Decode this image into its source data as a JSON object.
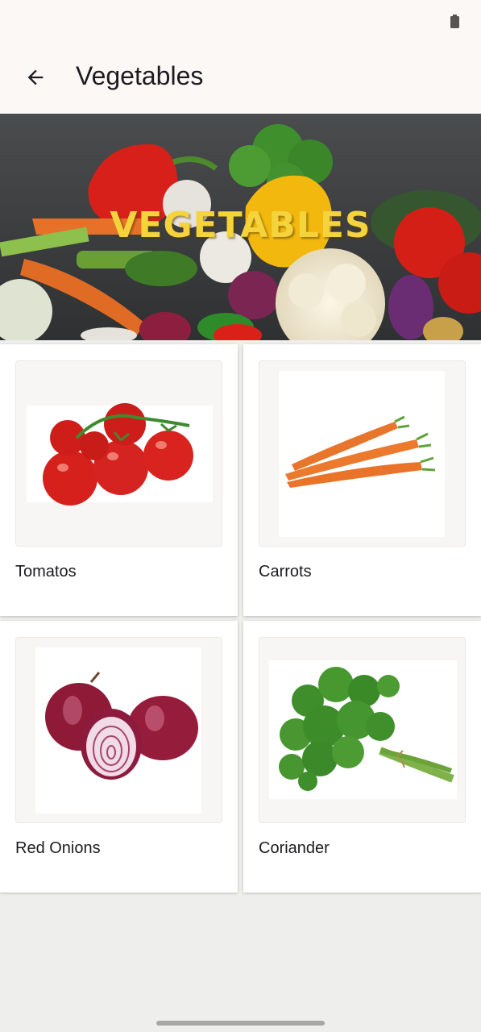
{
  "app_bar": {
    "title": "Vegetables"
  },
  "hero": {
    "banner_text": "VEGETABLES"
  },
  "items": [
    {
      "name": "Tomatos",
      "icon": "tomatoes-image"
    },
    {
      "name": "Carrots",
      "icon": "carrots-image"
    },
    {
      "name": "Red Onions",
      "icon": "red-onions-image"
    },
    {
      "name": "Coriander",
      "icon": "coriander-image"
    }
  ]
}
